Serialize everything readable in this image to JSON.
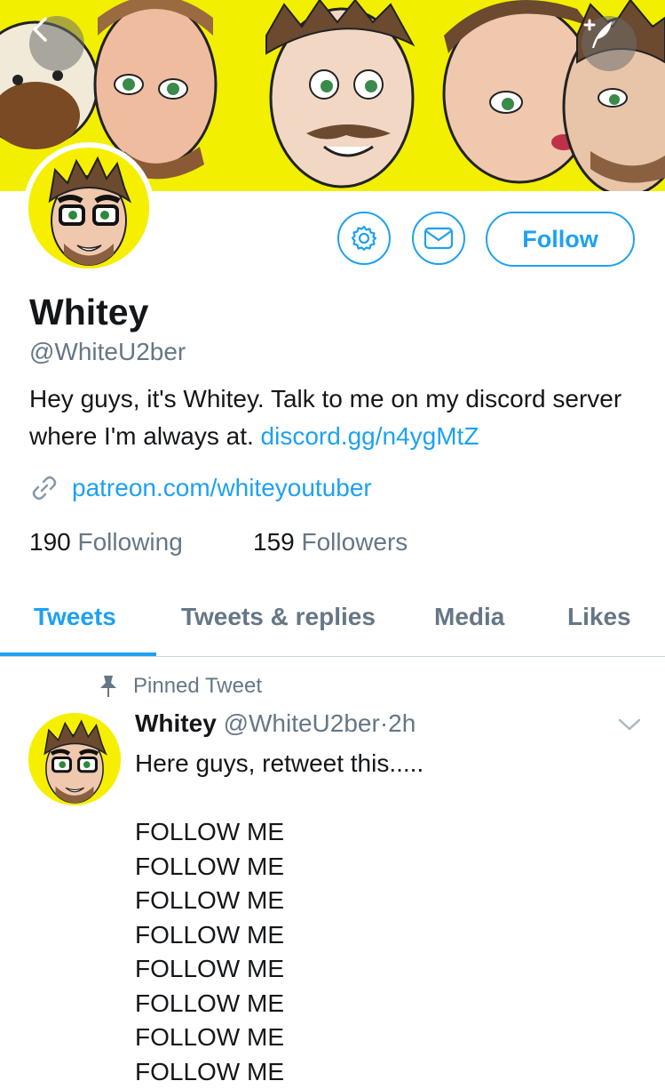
{
  "header": {
    "back_icon": "chevron-left-icon",
    "compose_icon": "compose-feather-icon",
    "banner_color": "#f3ef00"
  },
  "profile": {
    "name": "Whitey",
    "handle": "@WhiteU2ber",
    "bio_text": "Hey guys, it's Whitey. Talk to me on my discord server where I'm always at.",
    "bio_link": "discord.gg/n4ygMtZ",
    "website": "patreon.com/whiteyoutuber",
    "following_count": "190",
    "following_label": "Following",
    "followers_count": "159",
    "followers_label": "Followers",
    "follow_button": "Follow",
    "settings_icon": "gear-icon",
    "message_icon": "envelope-icon",
    "accent_color": "#1da1f2"
  },
  "tabs": [
    {
      "label": "Tweets",
      "active": true
    },
    {
      "label": "Tweets & replies",
      "active": false
    },
    {
      "label": "Media",
      "active": false
    },
    {
      "label": "Likes",
      "active": false
    }
  ],
  "tweet": {
    "pinned_label": "Pinned Tweet",
    "author_name": "Whitey",
    "author_handle": "@WhiteU2ber",
    "separator": "·",
    "time": "2h",
    "text": "Here guys, retweet this.....\n\nFOLLOW ME\nFOLLOW ME\nFOLLOW ME\nFOLLOW ME\nFOLLOW ME\nFOLLOW ME\nFOLLOW ME\nFOLLOW ME"
  }
}
